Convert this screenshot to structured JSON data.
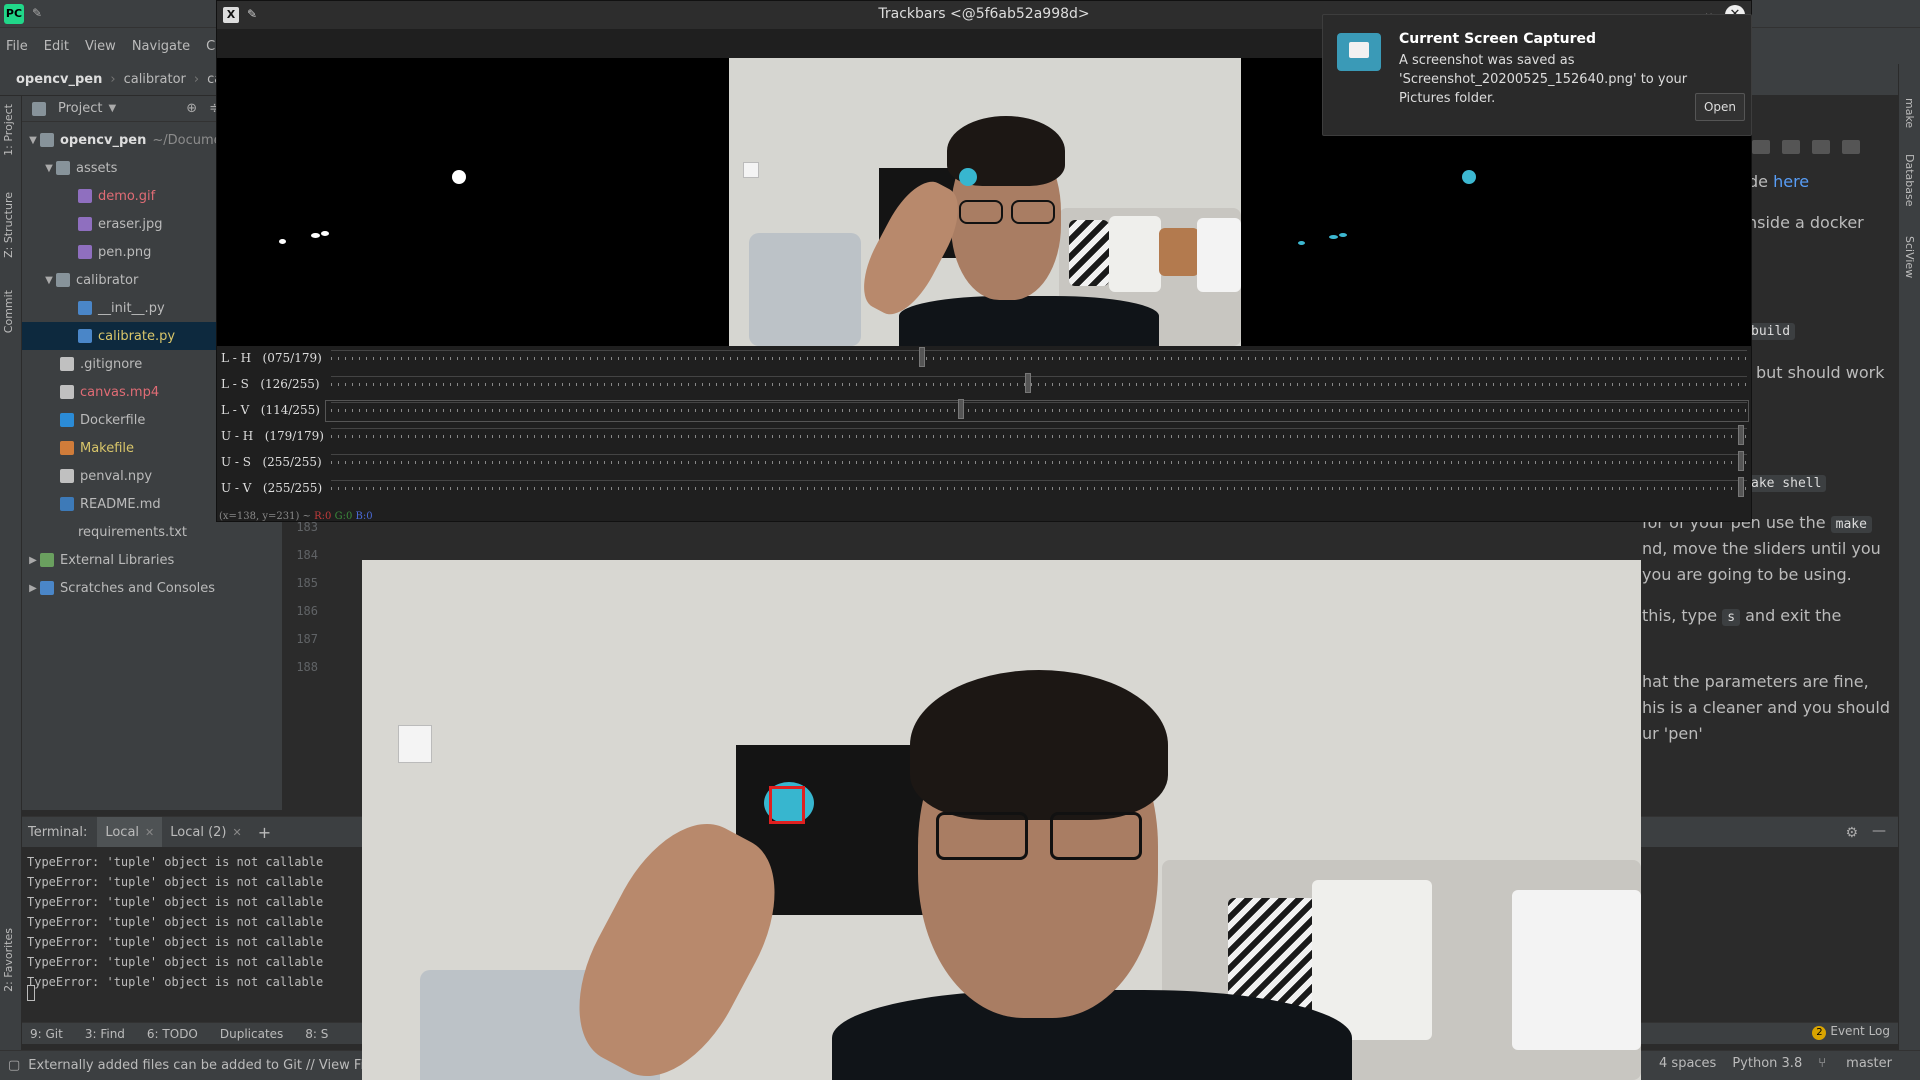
{
  "ide": {
    "menu": [
      "File",
      "Edit",
      "View",
      "Navigate",
      "Code"
    ],
    "breadcrumb": [
      "opencv_pen",
      "calibrator",
      "ca"
    ],
    "left_strip": [
      "1: Project",
      "Z: Structure",
      "Commit",
      "2: Favorites"
    ],
    "right_strip": [
      "make",
      "Database",
      "SciView"
    ],
    "project_panel": {
      "title": "Project",
      "root_label": "opencv_pen",
      "root_path": "~/Documen",
      "items": [
        {
          "label": "assets"
        },
        {
          "label": "demo.gif"
        },
        {
          "label": "eraser.jpg"
        },
        {
          "label": "pen.png"
        },
        {
          "label": "calibrator"
        },
        {
          "label": "__init__.py"
        },
        {
          "label": "calibrate.py"
        },
        {
          "label": ".gitignore"
        },
        {
          "label": "canvas.mp4"
        },
        {
          "label": "Dockerfile"
        },
        {
          "label": "Makefile"
        },
        {
          "label": "penval.npy"
        },
        {
          "label": "README.md"
        },
        {
          "label": "requirements.txt"
        },
        {
          "label": "External Libraries"
        },
        {
          "label": "Scratches and Consoles"
        }
      ]
    },
    "line_numbers": [
      "183",
      "184",
      "185",
      "186",
      "187",
      "188"
    ],
    "markdown_preview": {
      "line1_text": "de ",
      "line1_link": "here",
      "line2": "y inside a docker",
      "line3_code": "build",
      "line4": "but should work",
      "line5_code": "ake shell",
      "line6_a": "for of your pen use the ",
      "line6_code": "make",
      "line7": "nd, move the sliders until you",
      "line8": "you are going to be using.",
      "line9_a": "this, type ",
      "line9_code": "s",
      "line9_b": " and exit the",
      "line10": "hat the parameters are fine,",
      "line11": "his is a cleaner and you should",
      "line12": "ur 'pen'"
    },
    "terminal": {
      "label": "Terminal:",
      "tabs": [
        "Local",
        "Local (2)"
      ],
      "lines": [
        "TypeError: 'tuple' object is not callable",
        "TypeError: 'tuple' object is not callable",
        "TypeError: 'tuple' object is not callable",
        "TypeError: 'tuple' object is not callable",
        "TypeError: 'tuple' object is not callable",
        "TypeError: 'tuple' object is not callable",
        "TypeError: 'tuple' object is not callable"
      ]
    },
    "tool_bar": {
      "git": "9: Git",
      "find": "3: Find",
      "todo": "6: TODO",
      "duplicates": "Duplicates",
      "services": "8: S",
      "event_log": "Event Log",
      "event_count": "2"
    },
    "status": {
      "message": "Externally added files can be added to Git // View Files //",
      "indent": "4 spaces",
      "interpreter": "Python 3.8",
      "branch": "master"
    }
  },
  "trackbar_window": {
    "title": "Trackbars <@5f6ab52a998d>",
    "rows": [
      {
        "label": "L - H   (075/179)",
        "value": 75,
        "max": 179
      },
      {
        "label": "L - S   (126/255)",
        "value": 126,
        "max": 255
      },
      {
        "label": "L - V   (114/255)",
        "value": 114,
        "max": 255
      },
      {
        "label": "U - H   (179/179)",
        "value": 179,
        "max": 179
      },
      {
        "label": "U - S   (255/255)",
        "value": 255,
        "max": 255
      },
      {
        "label": "U - V   (255/255)",
        "value": 255,
        "max": 255
      }
    ],
    "status_prefix": "(x=138, y=231) ~",
    "status_r": "R:0",
    "status_g": "G:0",
    "status_b": "B:0"
  },
  "notification": {
    "title": "Current Screen Captured",
    "body": "A screenshot was saved as 'Screenshot_20200525_152640.png' to your Pictures folder.",
    "button": "Open"
  },
  "colors": {
    "ide_bg": "#2b2b2b",
    "panel_bg": "#3c3f41",
    "pen_blue": "#37b6cf",
    "detect_red": "#e02020"
  }
}
